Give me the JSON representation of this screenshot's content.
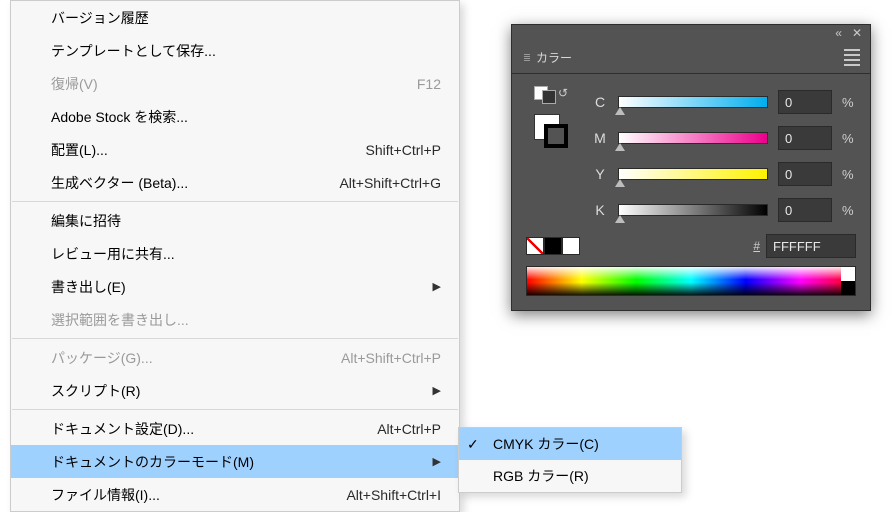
{
  "menu": {
    "items": [
      {
        "label": "バージョン履歴",
        "shortcut": "",
        "disabled": false,
        "hasSubmenu": false
      },
      {
        "label": "テンプレートとして保存...",
        "shortcut": "",
        "disabled": false,
        "hasSubmenu": false
      },
      {
        "label": "復帰(V)",
        "shortcut": "F12",
        "disabled": true,
        "hasSubmenu": false
      },
      {
        "label": "Adobe Stock を検索...",
        "shortcut": "",
        "disabled": false,
        "hasSubmenu": false
      },
      {
        "label": "配置(L)...",
        "shortcut": "Shift+Ctrl+P",
        "disabled": false,
        "hasSubmenu": false
      },
      {
        "label": "生成ベクター (Beta)...",
        "shortcut": "Alt+Shift+Ctrl+G",
        "disabled": false,
        "hasSubmenu": false
      },
      {
        "sep": true
      },
      {
        "label": "編集に招待",
        "shortcut": "",
        "disabled": false,
        "hasSubmenu": false
      },
      {
        "label": "レビュー用に共有...",
        "shortcut": "",
        "disabled": false,
        "hasSubmenu": false
      },
      {
        "label": "書き出し(E)",
        "shortcut": "",
        "disabled": false,
        "hasSubmenu": true
      },
      {
        "label": "選択範囲を書き出し...",
        "shortcut": "",
        "disabled": true,
        "hasSubmenu": false
      },
      {
        "sep": true
      },
      {
        "label": "パッケージ(G)...",
        "shortcut": "Alt+Shift+Ctrl+P",
        "disabled": true,
        "hasSubmenu": false
      },
      {
        "label": "スクリプト(R)",
        "shortcut": "",
        "disabled": false,
        "hasSubmenu": true
      },
      {
        "sep": true
      },
      {
        "label": "ドキュメント設定(D)...",
        "shortcut": "Alt+Ctrl+P",
        "disabled": false,
        "hasSubmenu": false
      },
      {
        "label": "ドキュメントのカラーモード(M)",
        "shortcut": "",
        "disabled": false,
        "hasSubmenu": true,
        "highlight": true
      },
      {
        "label": "ファイル情報(I)...",
        "shortcut": "Alt+Shift+Ctrl+I",
        "disabled": false,
        "hasSubmenu": false
      }
    ]
  },
  "submenu": {
    "items": [
      {
        "label": "CMYK カラー(C)",
        "checked": true,
        "highlight": true
      },
      {
        "label": "RGB カラー(R)",
        "checked": false,
        "highlight": false
      }
    ]
  },
  "panel": {
    "title": "カラー",
    "collapse_glyph": "«",
    "close_glyph": "✕",
    "channels": [
      {
        "name": "C",
        "value": "0",
        "pct": "%",
        "trackClass": "c"
      },
      {
        "name": "M",
        "value": "0",
        "pct": "%",
        "trackClass": "m"
      },
      {
        "name": "Y",
        "value": "0",
        "pct": "%",
        "trackClass": "y"
      },
      {
        "name": "K",
        "value": "0",
        "pct": "%",
        "trackClass": "k"
      }
    ],
    "hex_label": "#",
    "hex_value": "FFFFFF"
  }
}
